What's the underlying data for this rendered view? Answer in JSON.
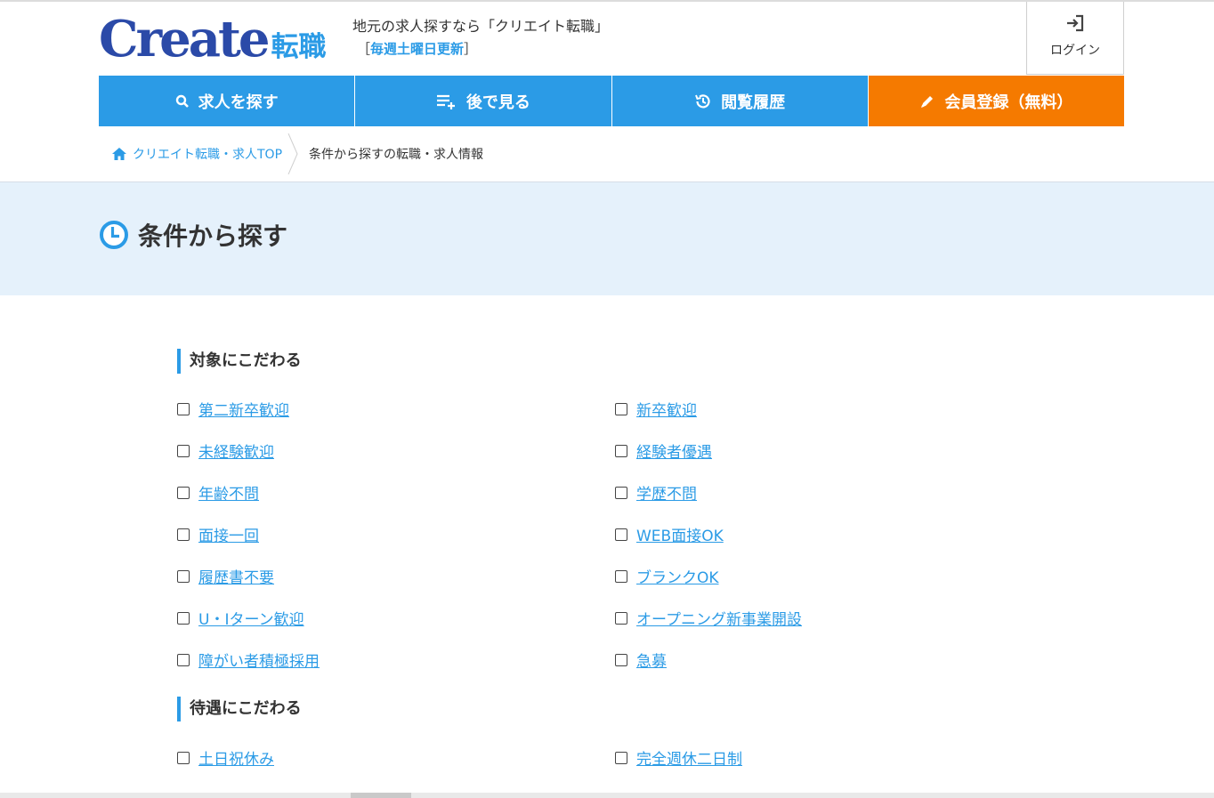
{
  "header": {
    "logo_create": "Create",
    "logo_tenshoku": "転職",
    "tagline": "地元の求人探すなら「クリエイト転職」",
    "update_open": "［",
    "update_text": "毎週土曜日更新",
    "update_close": "］",
    "login_label": "ログイン"
  },
  "nav": {
    "search": "求人を探す",
    "later": "後で見る",
    "history": "閲覧履歴",
    "register": "会員登録（無料）"
  },
  "breadcrumb": {
    "home": "クリエイト転職・求人TOP",
    "current": "条件から探すの転職・求人情報"
  },
  "page_title": "条件から探す",
  "sections": {
    "target": {
      "heading": "対象にこだわる",
      "left": [
        "第二新卒歓迎",
        "未経験歓迎",
        "年齢不問",
        "面接一回",
        "履歴書不要",
        "U・Iターン歓迎",
        "障がい者積極採用"
      ],
      "right": [
        "新卒歓迎",
        "経験者優遇",
        "学歴不問",
        "WEB面接OK",
        "ブランクOK",
        "オープニング新事業開設",
        "急募"
      ]
    },
    "treatment": {
      "heading": "待遇にこだわる",
      "left": [
        "土日祝休み"
      ],
      "right": [
        "完全週休二日制"
      ]
    }
  },
  "colors": {
    "accent_blue": "#2b9be6",
    "logo_navy": "#2b4aa8",
    "register_orange": "#f57a00",
    "title_band": "#e5f1fb"
  }
}
